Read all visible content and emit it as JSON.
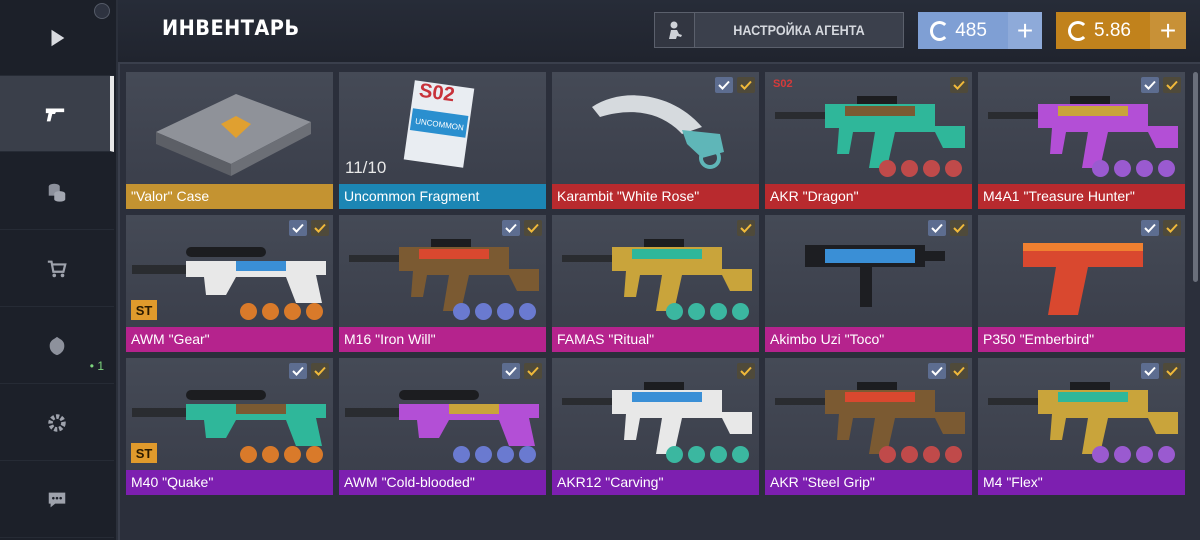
{
  "header": {
    "title": "ИНВЕНТАРЬ",
    "agent_button": "НАСТРОЙКА АГЕНТА",
    "silver": "485",
    "gold": "5.86",
    "plus": "+"
  },
  "sidebar": {
    "items": [
      {
        "name": "play-icon"
      },
      {
        "name": "gun-icon",
        "active": true
      },
      {
        "name": "coins-icon"
      },
      {
        "name": "cart-icon"
      },
      {
        "name": "clan-icon",
        "count": "• 1"
      },
      {
        "name": "gear-icon"
      },
      {
        "name": "chat-icon"
      }
    ]
  },
  "colors": {
    "gold": "#c49331",
    "blue": "#1c86b4",
    "red": "#b82a2e",
    "pink": "#b5238d",
    "purple": "#7d1fb0",
    "silver_currency": "#7f9fd4",
    "gold_currency": "#c1821c"
  },
  "inventory": {
    "items": [
      {
        "name": "\"Valor\" Case",
        "rarity": "gold",
        "kind": "case"
      },
      {
        "name": "Uncommon Fragment",
        "rarity": "blue",
        "kind": "fragment",
        "count": "11/10",
        "card_code": "S02",
        "card_text": "UNCOMMON"
      },
      {
        "name": "Karambit \"White Rose\"",
        "rarity": "red",
        "kind": "knife"
      },
      {
        "name": "AKR \"Dragon\"",
        "rarity": "red",
        "kind": "rifle",
        "tag": "S02"
      },
      {
        "name": "M4A1 \"Treasure Hunter\"",
        "rarity": "red",
        "kind": "rifle"
      },
      {
        "name": "AWM \"Gear\"",
        "rarity": "pink",
        "kind": "sniper",
        "st": "ST"
      },
      {
        "name": "M16 \"Iron Will\"",
        "rarity": "pink",
        "kind": "rifle"
      },
      {
        "name": "FAMAS \"Ritual\"",
        "rarity": "pink",
        "kind": "rifle"
      },
      {
        "name": "Akimbo Uzi \"Toco\"",
        "rarity": "pink",
        "kind": "smg"
      },
      {
        "name": "P350 \"Emberbird\"",
        "rarity": "pink",
        "kind": "pistol"
      },
      {
        "name": "M40 \"Quake\"",
        "rarity": "purple",
        "kind": "sniper",
        "st": "ST"
      },
      {
        "name": "AWM \"Cold-blooded\"",
        "rarity": "purple",
        "kind": "sniper"
      },
      {
        "name": "AKR12 \"Carving\"",
        "rarity": "purple",
        "kind": "rifle"
      },
      {
        "name": "AKR \"Steel Grip\"",
        "rarity": "purple",
        "kind": "rifle"
      },
      {
        "name": "M4 \"Flex\"",
        "rarity": "purple",
        "kind": "rifle"
      }
    ]
  }
}
